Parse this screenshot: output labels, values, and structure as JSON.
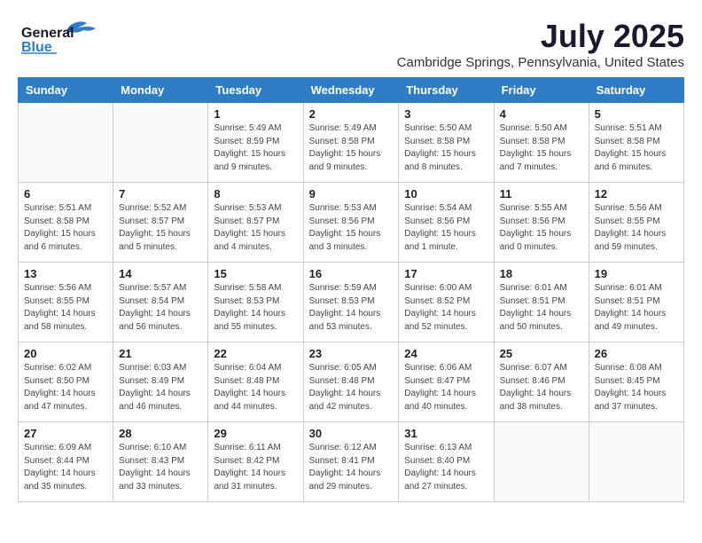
{
  "logo": {
    "line1": "General",
    "line2": "Blue"
  },
  "title": "July 2025",
  "location": "Cambridge Springs, Pennsylvania, United States",
  "weekdays": [
    "Sunday",
    "Monday",
    "Tuesday",
    "Wednesday",
    "Thursday",
    "Friday",
    "Saturday"
  ],
  "weeks": [
    [
      {
        "day": "",
        "sunrise": "",
        "sunset": "",
        "daylight": ""
      },
      {
        "day": "",
        "sunrise": "",
        "sunset": "",
        "daylight": ""
      },
      {
        "day": "1",
        "sunrise": "Sunrise: 5:49 AM",
        "sunset": "Sunset: 8:59 PM",
        "daylight": "Daylight: 15 hours and 9 minutes."
      },
      {
        "day": "2",
        "sunrise": "Sunrise: 5:49 AM",
        "sunset": "Sunset: 8:58 PM",
        "daylight": "Daylight: 15 hours and 9 minutes."
      },
      {
        "day": "3",
        "sunrise": "Sunrise: 5:50 AM",
        "sunset": "Sunset: 8:58 PM",
        "daylight": "Daylight: 15 hours and 8 minutes."
      },
      {
        "day": "4",
        "sunrise": "Sunrise: 5:50 AM",
        "sunset": "Sunset: 8:58 PM",
        "daylight": "Daylight: 15 hours and 7 minutes."
      },
      {
        "day": "5",
        "sunrise": "Sunrise: 5:51 AM",
        "sunset": "Sunset: 8:58 PM",
        "daylight": "Daylight: 15 hours and 6 minutes."
      }
    ],
    [
      {
        "day": "6",
        "sunrise": "Sunrise: 5:51 AM",
        "sunset": "Sunset: 8:58 PM",
        "daylight": "Daylight: 15 hours and 6 minutes."
      },
      {
        "day": "7",
        "sunrise": "Sunrise: 5:52 AM",
        "sunset": "Sunset: 8:57 PM",
        "daylight": "Daylight: 15 hours and 5 minutes."
      },
      {
        "day": "8",
        "sunrise": "Sunrise: 5:53 AM",
        "sunset": "Sunset: 8:57 PM",
        "daylight": "Daylight: 15 hours and 4 minutes."
      },
      {
        "day": "9",
        "sunrise": "Sunrise: 5:53 AM",
        "sunset": "Sunset: 8:56 PM",
        "daylight": "Daylight: 15 hours and 3 minutes."
      },
      {
        "day": "10",
        "sunrise": "Sunrise: 5:54 AM",
        "sunset": "Sunset: 8:56 PM",
        "daylight": "Daylight: 15 hours and 1 minute."
      },
      {
        "day": "11",
        "sunrise": "Sunrise: 5:55 AM",
        "sunset": "Sunset: 8:56 PM",
        "daylight": "Daylight: 15 hours and 0 minutes."
      },
      {
        "day": "12",
        "sunrise": "Sunrise: 5:56 AM",
        "sunset": "Sunset: 8:55 PM",
        "daylight": "Daylight: 14 hours and 59 minutes."
      }
    ],
    [
      {
        "day": "13",
        "sunrise": "Sunrise: 5:56 AM",
        "sunset": "Sunset: 8:55 PM",
        "daylight": "Daylight: 14 hours and 58 minutes."
      },
      {
        "day": "14",
        "sunrise": "Sunrise: 5:57 AM",
        "sunset": "Sunset: 8:54 PM",
        "daylight": "Daylight: 14 hours and 56 minutes."
      },
      {
        "day": "15",
        "sunrise": "Sunrise: 5:58 AM",
        "sunset": "Sunset: 8:53 PM",
        "daylight": "Daylight: 14 hours and 55 minutes."
      },
      {
        "day": "16",
        "sunrise": "Sunrise: 5:59 AM",
        "sunset": "Sunset: 8:53 PM",
        "daylight": "Daylight: 14 hours and 53 minutes."
      },
      {
        "day": "17",
        "sunrise": "Sunrise: 6:00 AM",
        "sunset": "Sunset: 8:52 PM",
        "daylight": "Daylight: 14 hours and 52 minutes."
      },
      {
        "day": "18",
        "sunrise": "Sunrise: 6:01 AM",
        "sunset": "Sunset: 8:51 PM",
        "daylight": "Daylight: 14 hours and 50 minutes."
      },
      {
        "day": "19",
        "sunrise": "Sunrise: 6:01 AM",
        "sunset": "Sunset: 8:51 PM",
        "daylight": "Daylight: 14 hours and 49 minutes."
      }
    ],
    [
      {
        "day": "20",
        "sunrise": "Sunrise: 6:02 AM",
        "sunset": "Sunset: 8:50 PM",
        "daylight": "Daylight: 14 hours and 47 minutes."
      },
      {
        "day": "21",
        "sunrise": "Sunrise: 6:03 AM",
        "sunset": "Sunset: 8:49 PM",
        "daylight": "Daylight: 14 hours and 46 minutes."
      },
      {
        "day": "22",
        "sunrise": "Sunrise: 6:04 AM",
        "sunset": "Sunset: 8:48 PM",
        "daylight": "Daylight: 14 hours and 44 minutes."
      },
      {
        "day": "23",
        "sunrise": "Sunrise: 6:05 AM",
        "sunset": "Sunset: 8:48 PM",
        "daylight": "Daylight: 14 hours and 42 minutes."
      },
      {
        "day": "24",
        "sunrise": "Sunrise: 6:06 AM",
        "sunset": "Sunset: 8:47 PM",
        "daylight": "Daylight: 14 hours and 40 minutes."
      },
      {
        "day": "25",
        "sunrise": "Sunrise: 6:07 AM",
        "sunset": "Sunset: 8:46 PM",
        "daylight": "Daylight: 14 hours and 38 minutes."
      },
      {
        "day": "26",
        "sunrise": "Sunrise: 6:08 AM",
        "sunset": "Sunset: 8:45 PM",
        "daylight": "Daylight: 14 hours and 37 minutes."
      }
    ],
    [
      {
        "day": "27",
        "sunrise": "Sunrise: 6:09 AM",
        "sunset": "Sunset: 8:44 PM",
        "daylight": "Daylight: 14 hours and 35 minutes."
      },
      {
        "day": "28",
        "sunrise": "Sunrise: 6:10 AM",
        "sunset": "Sunset: 8:43 PM",
        "daylight": "Daylight: 14 hours and 33 minutes."
      },
      {
        "day": "29",
        "sunrise": "Sunrise: 6:11 AM",
        "sunset": "Sunset: 8:42 PM",
        "daylight": "Daylight: 14 hours and 31 minutes."
      },
      {
        "day": "30",
        "sunrise": "Sunrise: 6:12 AM",
        "sunset": "Sunset: 8:41 PM",
        "daylight": "Daylight: 14 hours and 29 minutes."
      },
      {
        "day": "31",
        "sunrise": "Sunrise: 6:13 AM",
        "sunset": "Sunset: 8:40 PM",
        "daylight": "Daylight: 14 hours and 27 minutes."
      },
      {
        "day": "",
        "sunrise": "",
        "sunset": "",
        "daylight": ""
      },
      {
        "day": "",
        "sunrise": "",
        "sunset": "",
        "daylight": ""
      }
    ]
  ]
}
